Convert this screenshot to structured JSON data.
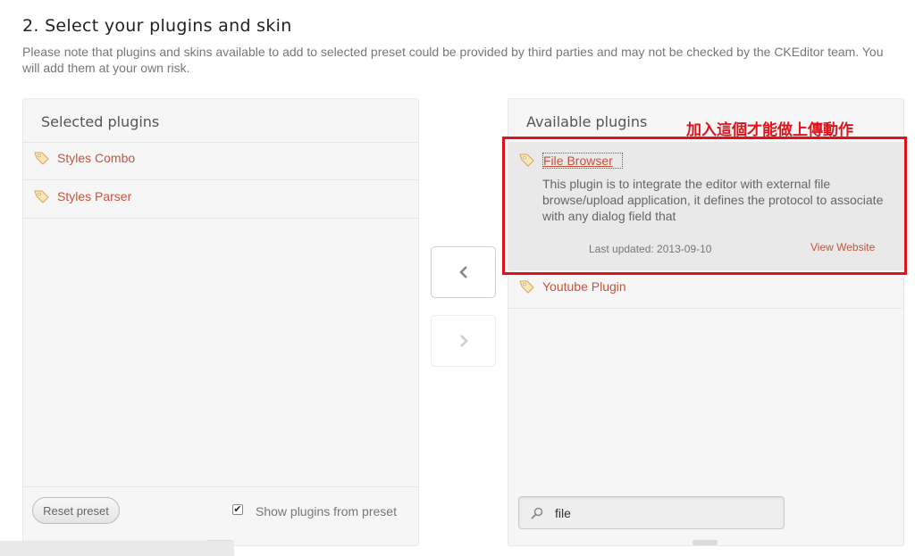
{
  "header": {
    "title": "2. Select your plugins and skin",
    "note": "Please note that plugins and skins available to add to selected preset could be provided by third parties and may not be checked by the CKEditor team. You will add them at your own risk."
  },
  "selected_panel": {
    "title": "Selected plugins",
    "items": [
      {
        "label": "Styles Combo"
      },
      {
        "label": "Styles Parser"
      }
    ],
    "reset_label": "Reset preset",
    "show_from_preset_label": "Show plugins from preset",
    "show_from_preset_checked": true
  },
  "move_buttons": {
    "add_icon": "chevron-left-icon",
    "remove_icon": "chevron-right-icon"
  },
  "available_panel": {
    "title": "Available plugins",
    "selected_plugin": {
      "label": "File Browser",
      "description_lines": [
        "This plugin is to integrate the editor with external file",
        "browse/upload application, it defines the protocol to associate",
        "with any dialog field that"
      ],
      "last_updated": "Last updated: 2013-09-10",
      "view_website": "View Website"
    },
    "items": [
      {
        "label": "Youtube Plugin"
      }
    ],
    "search_value": "file"
  },
  "annotation": {
    "text": "加入這個才能做上傳動作",
    "color": "#e0131b"
  },
  "colors": {
    "link": "#c7533a",
    "panel_bg": "#f6f6f6",
    "highlight_bg": "#e9e9e9"
  }
}
